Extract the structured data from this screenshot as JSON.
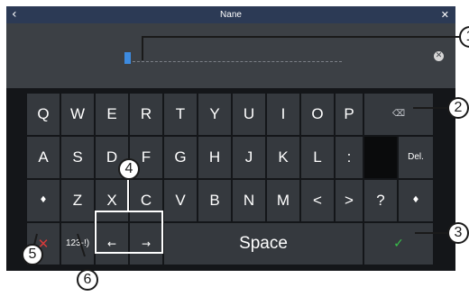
{
  "titlebar": {
    "back_icon": "‹",
    "title": "Nane",
    "close_icon": "✕"
  },
  "input": {
    "value": "",
    "clear_icon": "✕"
  },
  "keyboard": {
    "row1": [
      "Q",
      "W",
      "E",
      "R",
      "T",
      "Y",
      "U",
      "I",
      "O",
      "P"
    ],
    "backspace_icon": "⌫",
    "row2": [
      "A",
      "S",
      "D",
      "F",
      "G",
      "H",
      "J",
      "K",
      "L",
      ":"
    ],
    "delete_label": "Del.",
    "row3": [
      "Z",
      "X",
      "C",
      "V",
      "B",
      "N",
      "M",
      "<",
      ">",
      "?"
    ],
    "shift_icon": "♦",
    "cancel_icon": "✕",
    "mode_label": "123-!)",
    "left_arrow": "←",
    "right_arrow": "→",
    "space_label": "Space",
    "ok_icon": "✓"
  },
  "callouts": [
    "1",
    "2",
    "3",
    "4",
    "5",
    "6"
  ],
  "colors": {
    "titlebar": "#2c3a55",
    "input_bg": "#3c4045",
    "key": "#35393e",
    "cursor": "#3d8be0",
    "cancel": "#d83a3a",
    "ok": "#38c04a"
  }
}
